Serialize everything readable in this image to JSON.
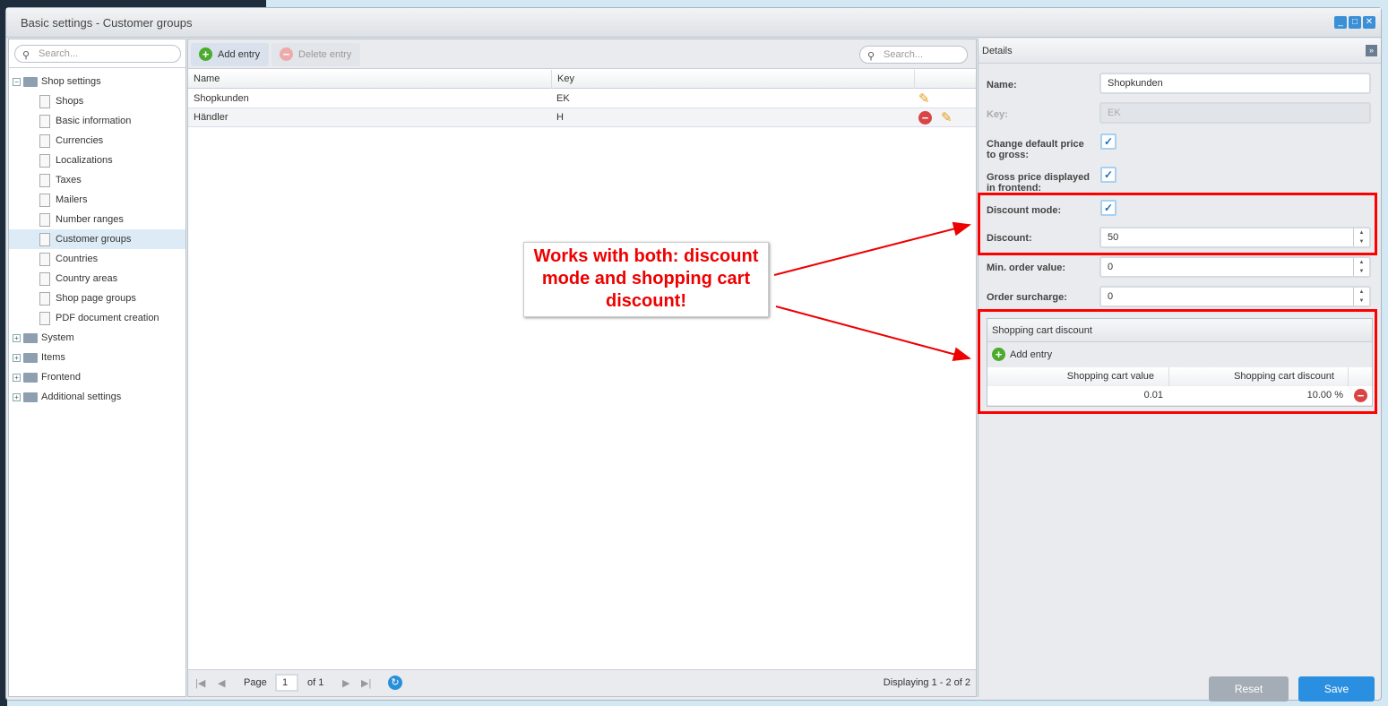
{
  "window": {
    "title": "Basic settings - Customer groups"
  },
  "tree": {
    "search_placeholder": "Search...",
    "root": "Shop settings",
    "items": [
      "Shops",
      "Basic information",
      "Currencies",
      "Localizations",
      "Taxes",
      "Mailers",
      "Number ranges",
      "Customer groups",
      "Countries",
      "Country areas",
      "Shop page groups",
      "PDF document creation"
    ],
    "selected": "Customer groups",
    "folders": [
      "System",
      "Items",
      "Frontend",
      "Additional settings"
    ]
  },
  "grid": {
    "add_label": "Add entry",
    "delete_label": "Delete entry",
    "search_placeholder": "Search...",
    "columns": [
      "Name",
      "Key"
    ],
    "rows": [
      {
        "name": "Shopkunden",
        "key": "EK"
      },
      {
        "name": "Händler",
        "key": "H"
      }
    ],
    "pager": {
      "page_label": "Page",
      "page": "1",
      "of": "of 1",
      "display": "Displaying 1 - 2 of 2"
    }
  },
  "details": {
    "title": "Details",
    "name_label": "Name:",
    "name_value": "Shopkunden",
    "key_label": "Key:",
    "key_value": "EK",
    "gross_label": "Change default price to gross:",
    "gross_checked": true,
    "frontend_label": "Gross price displayed in frontend:",
    "frontend_checked": true,
    "discount_mode_label": "Discount mode:",
    "discount_mode_checked": true,
    "discount_label": "Discount:",
    "discount_value": "50",
    "min_order_label": "Min. order value:",
    "min_order_value": "0",
    "surcharge_label": "Order surcharge:",
    "surcharge_value": "0",
    "cart": {
      "title": "Shopping cart discount",
      "add_label": "Add entry",
      "columns": [
        "Shopping cart value",
        "Shopping cart discount"
      ],
      "rows": [
        {
          "value": "0.01",
          "discount": "10.00 %"
        }
      ]
    },
    "reset_label": "Reset",
    "save_label": "Save"
  },
  "annotation": {
    "text": "Works with both: discount mode and shopping cart discount!",
    "color": "#ff0000"
  }
}
